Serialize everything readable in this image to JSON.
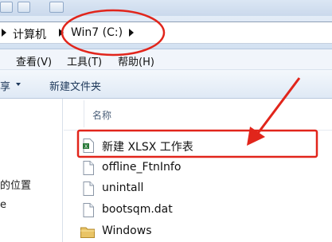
{
  "address_bar": {
    "crumbs": [
      "计算机",
      "Win7 (C:)"
    ]
  },
  "menu": {
    "items": [
      "查看(V)",
      "工具(T)",
      "帮助(H)"
    ]
  },
  "command_bar": {
    "share_label": "享",
    "new_folder_label": "新建文件夹"
  },
  "nav_pane": {
    "items": [
      "的位置",
      "e"
    ]
  },
  "file_list": {
    "column_name": "名称",
    "files": [
      {
        "name": "新建 XLSX 工作表",
        "icon": "xlsx-file-icon"
      },
      {
        "name": "offline_FtnInfo",
        "icon": "file-icon"
      },
      {
        "name": "unintall",
        "icon": "file-icon"
      },
      {
        "name": "bootsqm.dat",
        "icon": "file-icon"
      },
      {
        "name": "Windows",
        "icon": "folder-icon"
      }
    ]
  },
  "colors": {
    "annotation_red": "#e1251b",
    "explorer_blue": "#1e395b"
  }
}
